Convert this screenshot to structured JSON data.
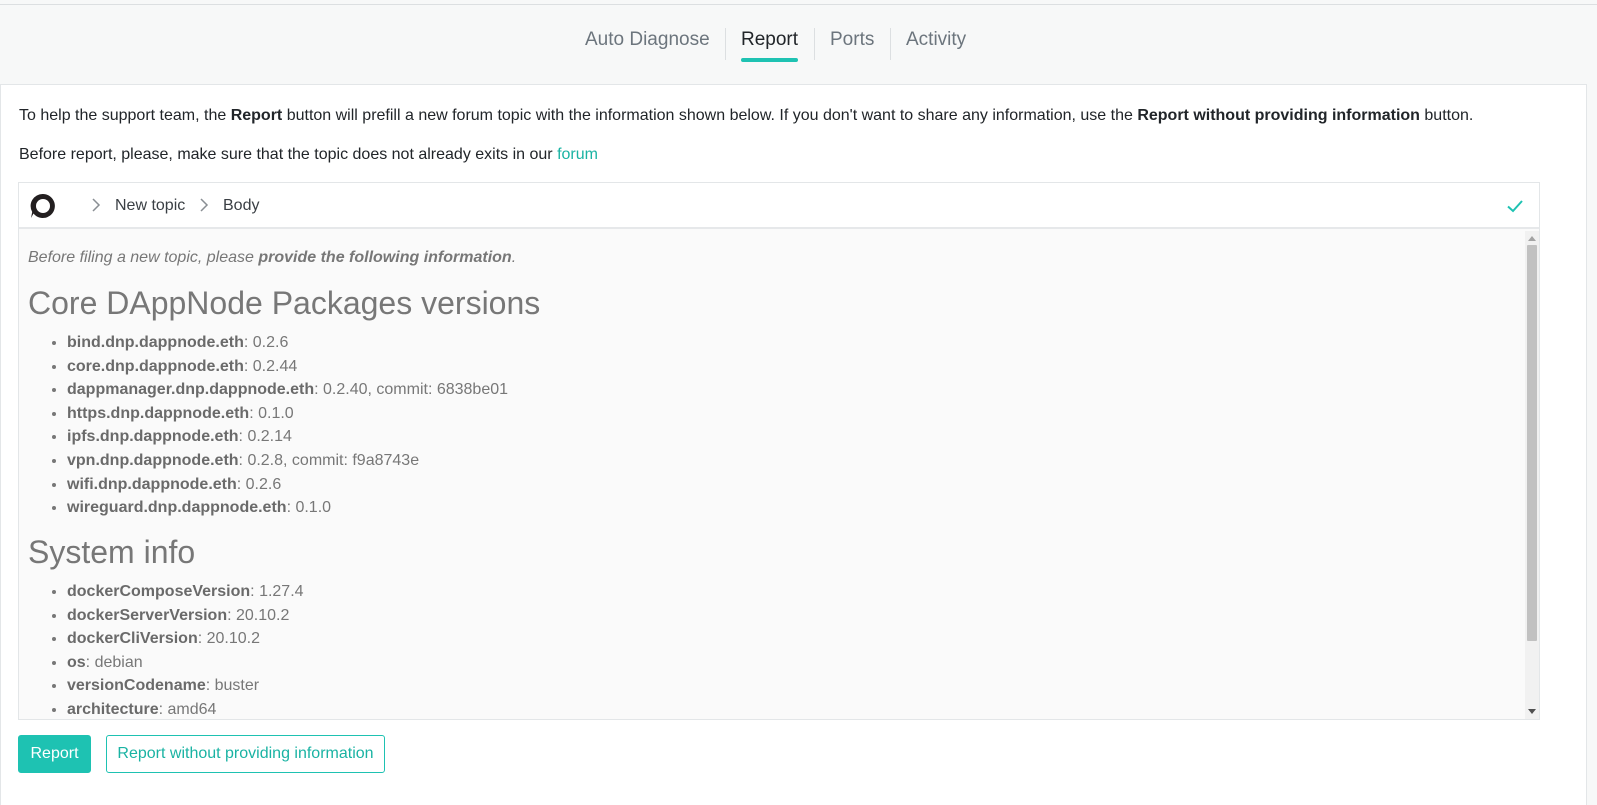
{
  "tabs": [
    {
      "label": "Auto Diagnose",
      "active": false
    },
    {
      "label": "Report",
      "active": true
    },
    {
      "label": "Ports",
      "active": false
    },
    {
      "label": "Activity",
      "active": false
    }
  ],
  "intro": {
    "p1_a": "To help the support team, the ",
    "p1_b": "Report",
    "p1_c": " button will prefill a new forum topic with the information shown below. If you don't want to share any information, use the ",
    "p1_d": "Report without providing information",
    "p1_e": " button.",
    "p2_a": "Before report, please, make sure that the topic does not already exits in our ",
    "p2_link": "forum"
  },
  "editor": {
    "logo_icon": "discourse-logo-icon",
    "breadcrumb": [
      "New topic",
      "Body"
    ],
    "status_icon": "check-icon",
    "lead_a": "Before filing a new topic, please ",
    "lead_b": "provide the following information",
    "lead_c": ".",
    "sections": [
      {
        "heading": "Core DAppNode Packages versions",
        "items": [
          {
            "key": "bind.dnp.dappnode.eth",
            "value": ": 0.2.6"
          },
          {
            "key": "core.dnp.dappnode.eth",
            "value": ": 0.2.44"
          },
          {
            "key": "dappmanager.dnp.dappnode.eth",
            "value": ": 0.2.40, commit: 6838be01"
          },
          {
            "key": "https.dnp.dappnode.eth",
            "value": ": 0.1.0"
          },
          {
            "key": "ipfs.dnp.dappnode.eth",
            "value": ": 0.2.14"
          },
          {
            "key": "vpn.dnp.dappnode.eth",
            "value": ": 0.2.8, commit: f9a8743e"
          },
          {
            "key": "wifi.dnp.dappnode.eth",
            "value": ": 0.2.6"
          },
          {
            "key": "wireguard.dnp.dappnode.eth",
            "value": ": 0.1.0"
          }
        ]
      },
      {
        "heading": "System info",
        "items": [
          {
            "key": "dockerComposeVersion",
            "value": ": 1.27.4"
          },
          {
            "key": "dockerServerVersion",
            "value": ": 20.10.2"
          },
          {
            "key": "dockerCliVersion",
            "value": ": 20.10.2"
          },
          {
            "key": "os",
            "value": ": debian"
          },
          {
            "key": "versionCodename",
            "value": ": buster"
          },
          {
            "key": "architecture",
            "value": ": amd64"
          }
        ]
      }
    ]
  },
  "buttons": {
    "report": "Report",
    "report_anon": "Report without providing information"
  },
  "colors": {
    "accent": "#1ec2b2",
    "link": "#1ab3a3"
  }
}
